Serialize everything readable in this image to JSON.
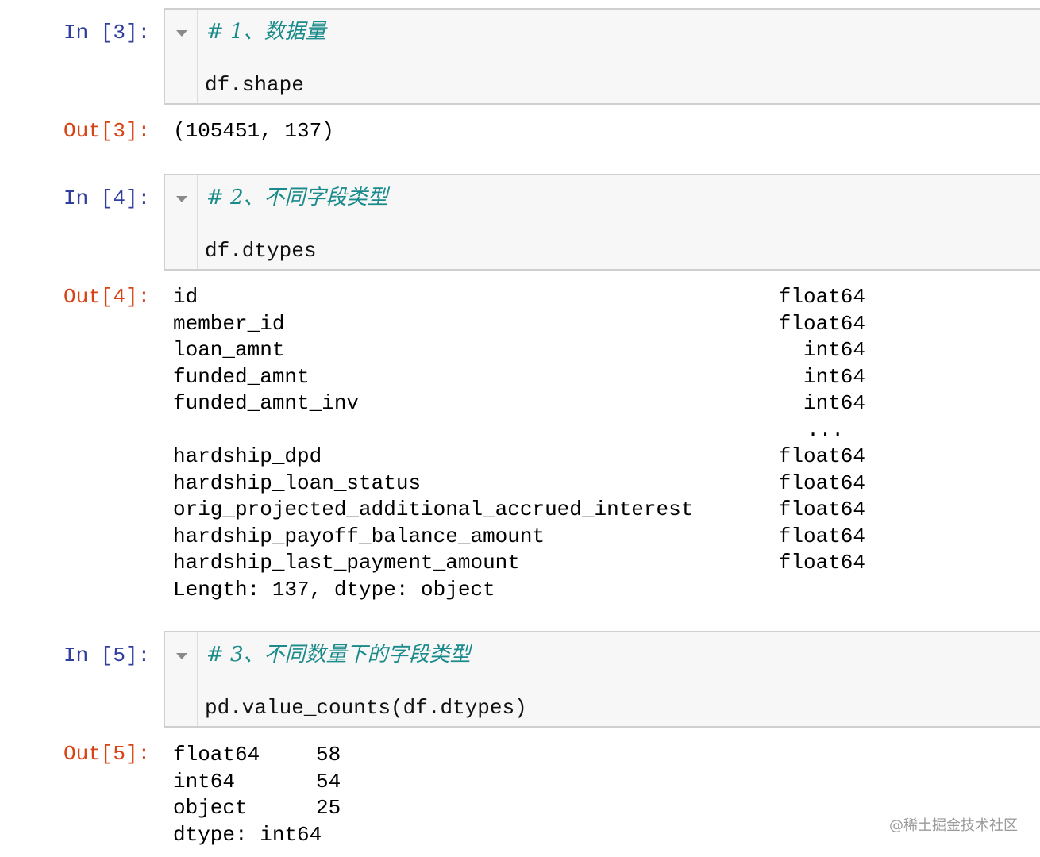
{
  "cells": [
    {
      "in_prompt": "In [3]:",
      "comment": "# 1、数据量",
      "code": "df.shape",
      "out_prompt": "Out[3]:",
      "output": "(105451, 137)"
    },
    {
      "in_prompt": "In [4]:",
      "comment": "# 2、不同字段类型",
      "code": "df.dtypes",
      "out_prompt": "Out[4]:",
      "rows": [
        {
          "name": "id",
          "type": "float64"
        },
        {
          "name": "member_id",
          "type": "float64"
        },
        {
          "name": "loan_amnt",
          "type": "int64"
        },
        {
          "name": "funded_amnt",
          "type": "int64"
        },
        {
          "name": "funded_amnt_inv",
          "type": "int64"
        },
        {
          "name": "",
          "type": "..."
        },
        {
          "name": "hardship_dpd",
          "type": "float64"
        },
        {
          "name": "hardship_loan_status",
          "type": "float64"
        },
        {
          "name": "orig_projected_additional_accrued_interest",
          "type": "float64"
        },
        {
          "name": "hardship_payoff_balance_amount",
          "type": "float64"
        },
        {
          "name": "hardship_last_payment_amount",
          "type": "float64"
        },
        {
          "name": "Length: 137, dtype: object",
          "type": ""
        }
      ]
    },
    {
      "in_prompt": "In [5]:",
      "comment": "# 3、不同数量下的字段类型",
      "code": "pd.value_counts(df.dtypes)",
      "out_prompt": "Out[5]:",
      "rows": [
        {
          "name": "float64",
          "count": "58"
        },
        {
          "name": "int64",
          "count": "54"
        },
        {
          "name": "object",
          "count": "25"
        },
        {
          "name": "dtype: int64",
          "count": ""
        }
      ]
    }
  ],
  "watermark": "@稀土掘金技术社区",
  "colors": {
    "in_prompt": "#303F9F",
    "out_prompt": "#D84315",
    "comment": "#1a8a8a",
    "cell_bg": "#f7f7f7"
  }
}
